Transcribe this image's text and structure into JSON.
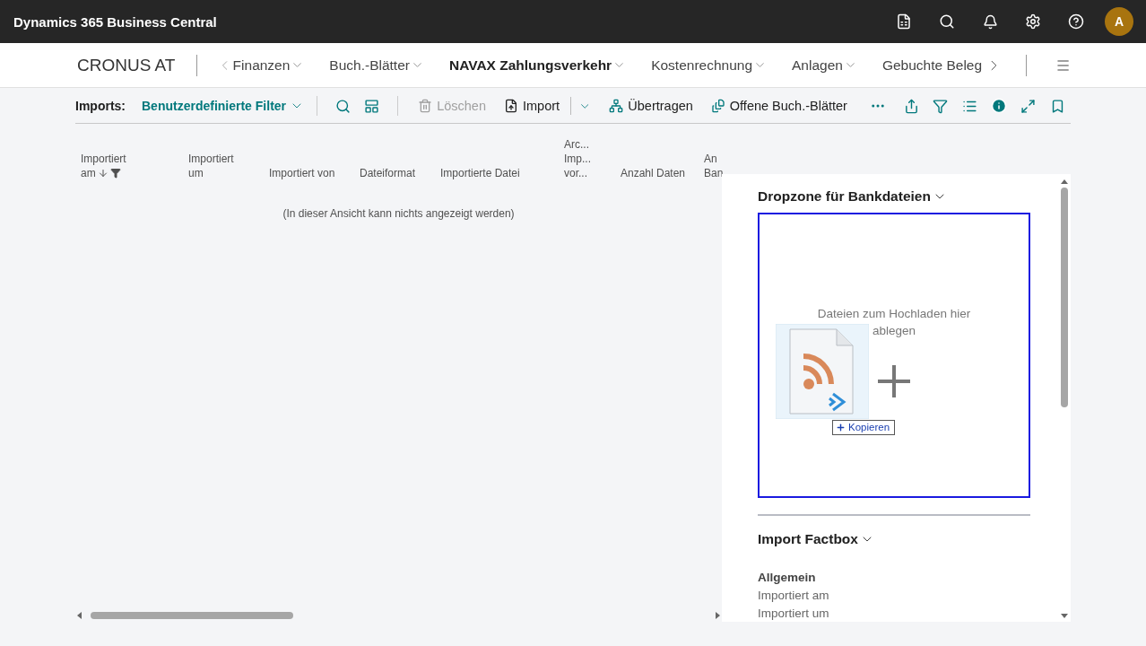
{
  "app_bar": {
    "title": "Dynamics 365 Business Central",
    "avatar_initial": "A"
  },
  "nav": {
    "company": "CRONUS AT",
    "items": [
      {
        "label": "Finanzen",
        "selected": false,
        "has_menu": true
      },
      {
        "label": "Buch.-Blätter",
        "selected": false,
        "has_menu": true
      },
      {
        "label": "NAVAX Zahlungsverkehr",
        "selected": true,
        "has_menu": true
      },
      {
        "label": "Kostenrechnung",
        "selected": false,
        "has_menu": true
      },
      {
        "label": "Anlagen",
        "selected": false,
        "has_menu": true
      },
      {
        "label": "Gebuchte Beleg",
        "selected": false,
        "has_menu": false
      }
    ]
  },
  "toolbar": {
    "label": "Imports:",
    "filter": "Benutzerdefinierte Filter",
    "actions": [
      {
        "kind": "delete",
        "label": "Löschen",
        "disabled": true
      },
      {
        "kind": "import",
        "label": "Import",
        "disabled": false
      },
      {
        "kind": "transfer",
        "label": "Übertragen",
        "disabled": false
      },
      {
        "kind": "journals",
        "label": "Offene Buch.-Blätter",
        "disabled": false
      }
    ]
  },
  "table": {
    "columns": [
      {
        "lines": [
          "Importiert",
          "am"
        ],
        "sorted": true,
        "filtered": true
      },
      {
        "lines": [
          "Importiert",
          "um"
        ],
        "sorted": false,
        "filtered": false
      },
      {
        "lines": [
          "Importiert von"
        ],
        "sorted": false,
        "filtered": false
      },
      {
        "lines": [
          "Dateiformat"
        ],
        "sorted": false,
        "filtered": false
      },
      {
        "lines": [
          "Importierte Datei"
        ],
        "sorted": false,
        "filtered": false
      },
      {
        "lines": [
          "Arc...",
          "Imp...",
          "vor..."
        ],
        "sorted": false,
        "filtered": false
      },
      {
        "lines": [
          "Anzahl Daten"
        ],
        "sorted": false,
        "filtered": false
      },
      {
        "lines": [
          "An",
          "Ban"
        ],
        "sorted": false,
        "filtered": false
      }
    ],
    "empty_message": "(In dieser Ansicht kann nichts angezeigt werden)"
  },
  "factbox": {
    "dropzone": {
      "title": "Dropzone für Bankdateien",
      "hint": "Dateien zum Hochladen hier ablegen",
      "drag_label": "Kopieren"
    },
    "import_factbox": {
      "title": "Import Factbox",
      "section": "Allgemein",
      "fields": [
        "Importiert am",
        "Importiert um"
      ]
    }
  }
}
